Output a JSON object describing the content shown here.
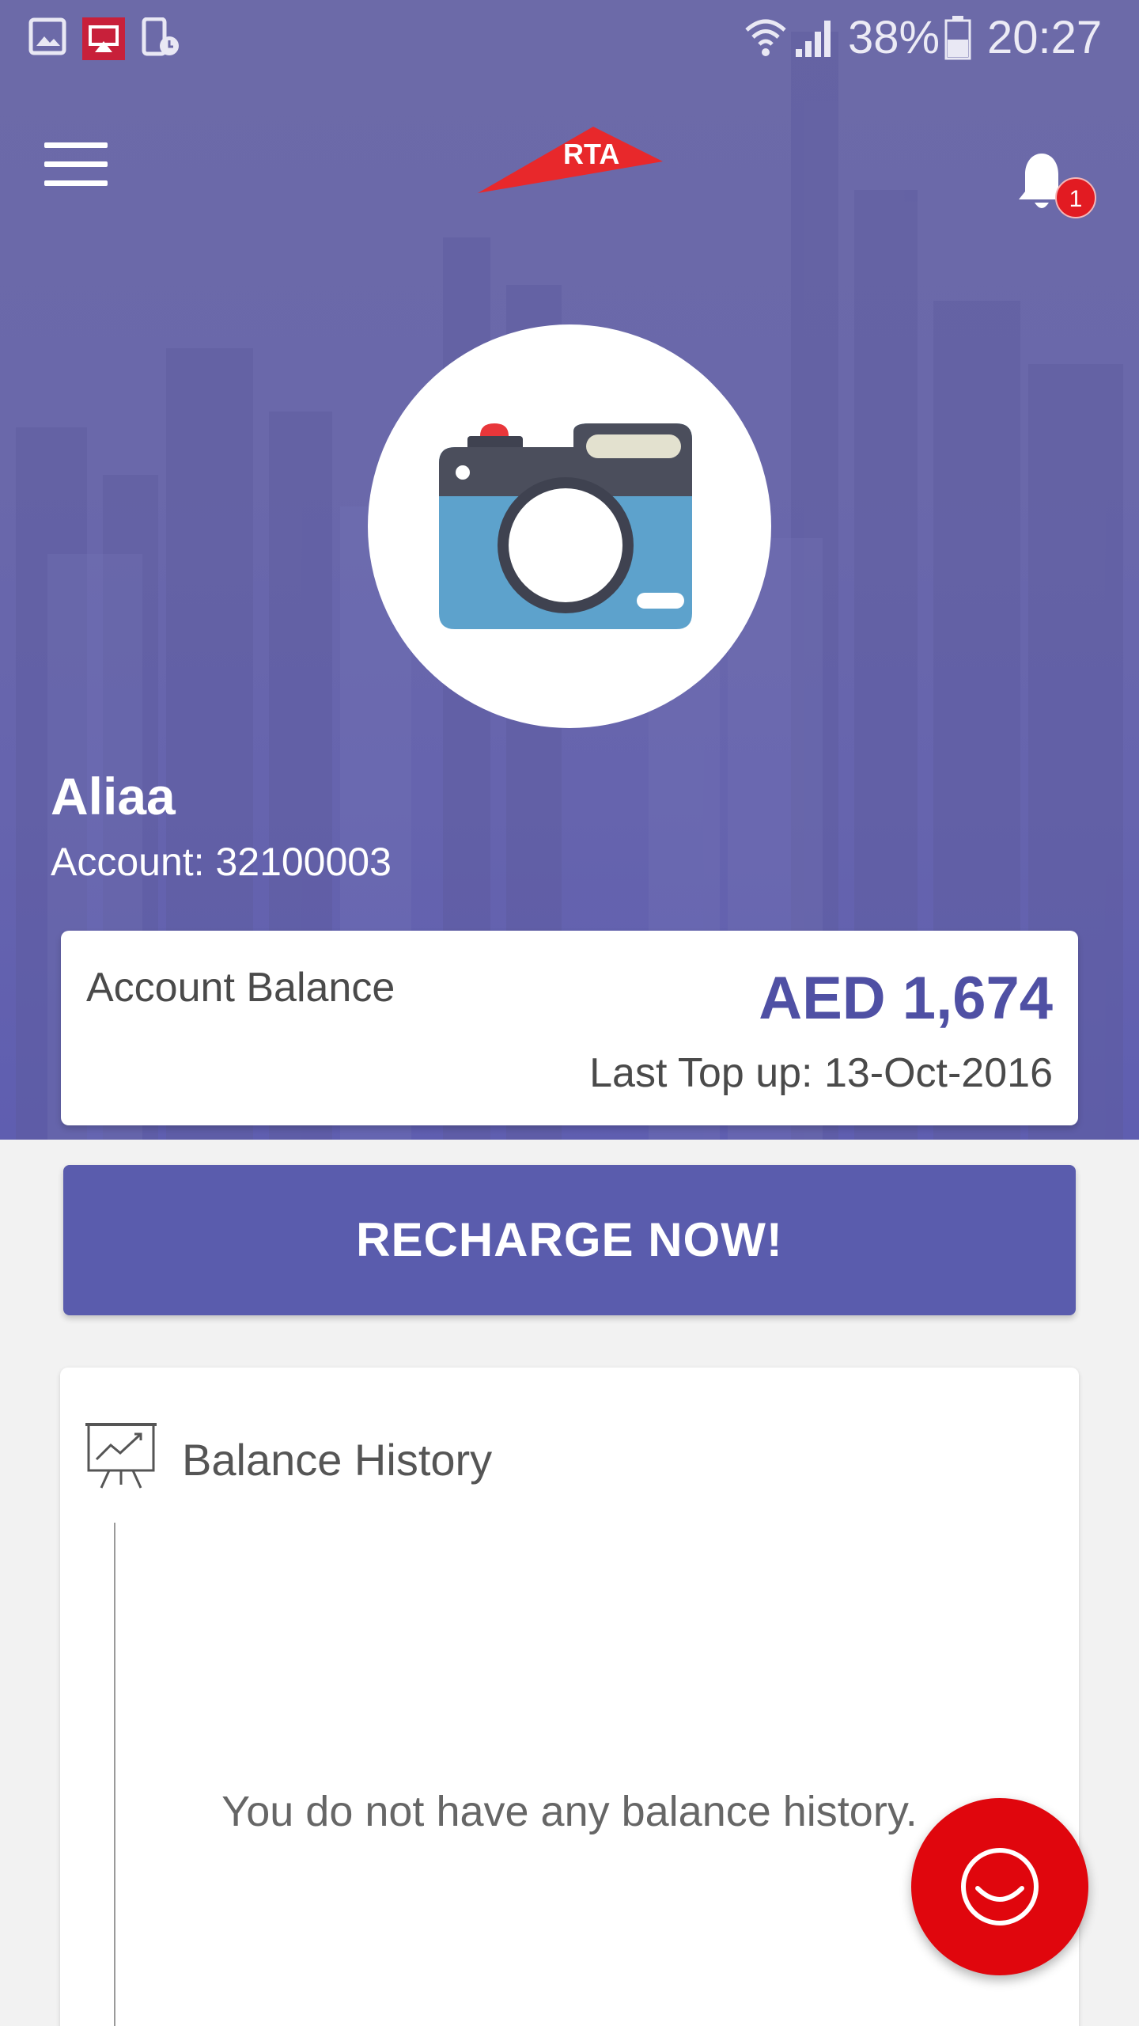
{
  "status_bar": {
    "battery_percent": "38%",
    "time": "20:27",
    "icons": [
      "gallery-icon",
      "cast-icon",
      "phone-clock-icon",
      "wifi-icon",
      "signal-icon",
      "battery-icon"
    ]
  },
  "app_bar": {
    "logo_text": "RTA",
    "notification_count": "1",
    "icons": [
      "menu-icon",
      "bell-icon"
    ]
  },
  "profile": {
    "name": "Aliaa",
    "account": "Account: 32100003",
    "avatar_icon": "camera-icon"
  },
  "balance_card": {
    "label": "Account Balance",
    "amount": "AED 1,674",
    "last_topup": "Last Top up: 13-Oct-2016"
  },
  "recharge": {
    "label": "RECHARGE NOW!"
  },
  "history": {
    "title": "Balance History",
    "empty_message": "You do not have any balance history.",
    "icon": "presentation-chart-icon"
  },
  "fab": {
    "icon": "smile-icon"
  },
  "colors": {
    "header": "#6a68aa",
    "accent": "#5a5cad",
    "balance_text": "#4f50a4",
    "fab": "#e0060d",
    "logo": "#e8282b"
  }
}
